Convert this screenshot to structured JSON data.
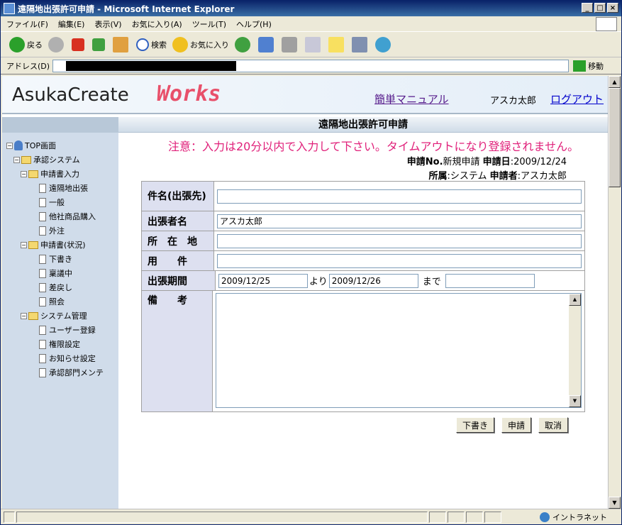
{
  "window": {
    "title": "遠隔地出張許可申請 - Microsoft Internet Explorer",
    "min": "_",
    "max": "□",
    "close": "×"
  },
  "menu": [
    "ファイル(F)",
    "編集(E)",
    "表示(V)",
    "お気に入り(A)",
    "ツール(T)",
    "ヘルプ(H)"
  ],
  "toolbar": {
    "back": "戻る",
    "search": "検索",
    "favorites": "お気に入り"
  },
  "address": {
    "label": "アドレス(D)",
    "go": "移動"
  },
  "header": {
    "logo_main": "AsukaCreate",
    "logo_works": "Works",
    "manual": "簡単マニュアル",
    "user": "アスカ太郎",
    "logout": "ログアウト"
  },
  "page_title": "遠隔地出張許可申請",
  "tree": {
    "top": "TOP画面",
    "system": "承認システム",
    "input_group": "申請書入力",
    "input_items": [
      "遠隔地出張",
      "一般",
      "他社商品購入",
      "外注"
    ],
    "status_group": "申請書(状況)",
    "status_items": [
      "下書き",
      "稟議中",
      "差戻し",
      "照会"
    ],
    "admin_group": "システム管理",
    "admin_items": [
      "ユーザー登録",
      "権限設定",
      "お知らせ設定",
      "承認部門メンテ"
    ]
  },
  "notice": "注意：入力は20分以内で入力して下さい。タイムアウトになり登録されません。",
  "meta": {
    "no_label": "申請No.",
    "no_value": "新規申請",
    "date_label": "申請日",
    "date_value": ":2009/12/24",
    "dept_label": "所属",
    "dept_value": ":システム",
    "applicant_label": "申請者",
    "applicant_value": ":アスカ太郎"
  },
  "form": {
    "subject_label": "件名(出張先)",
    "subject_value": "",
    "traveler_label": "出張者名",
    "traveler_value": "アスカ太郎",
    "location_label": "所　在　地",
    "location_value": "",
    "purpose_label": "用　　件",
    "purpose_value": "",
    "period_label": "出張期間",
    "period_from": "2009/12/25",
    "from_sep": "より",
    "period_to": "2009/12/26",
    "to_sep": "まで",
    "period_extra": "",
    "remarks_label": "備　　考",
    "remarks_value": ""
  },
  "buttons": {
    "draft": "下書き",
    "apply": "申請",
    "cancel": "取消"
  },
  "status": {
    "zone": "イントラネット"
  }
}
